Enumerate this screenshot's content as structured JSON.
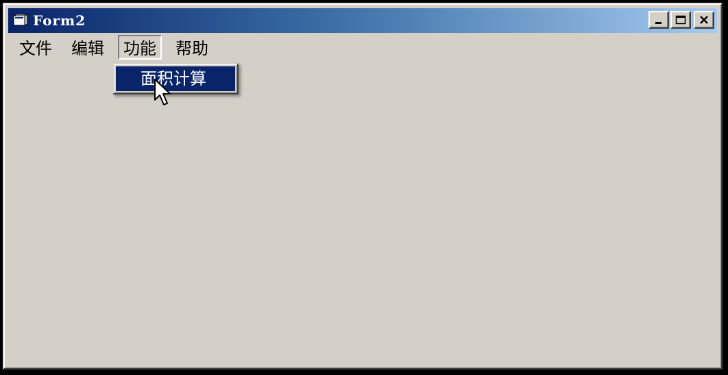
{
  "window": {
    "title": "Form2",
    "title_icon": "vb-form-icon",
    "controls": {
      "minimize_icon": "minimize-icon",
      "maximize_icon": "maximize-icon",
      "close_icon": "close-icon"
    }
  },
  "menubar": {
    "items": [
      {
        "label": "文件",
        "active": false
      },
      {
        "label": "编辑",
        "active": false
      },
      {
        "label": "功能",
        "active": true
      },
      {
        "label": "帮助",
        "active": false
      }
    ]
  },
  "dropdown": {
    "items": [
      {
        "label": "面积计算",
        "highlighted": true
      }
    ]
  },
  "colors": {
    "titlebar_start": "#0a246a",
    "titlebar_end": "#a6caf0",
    "window_bg": "#d4d0c8",
    "highlight": "#0a246a"
  }
}
